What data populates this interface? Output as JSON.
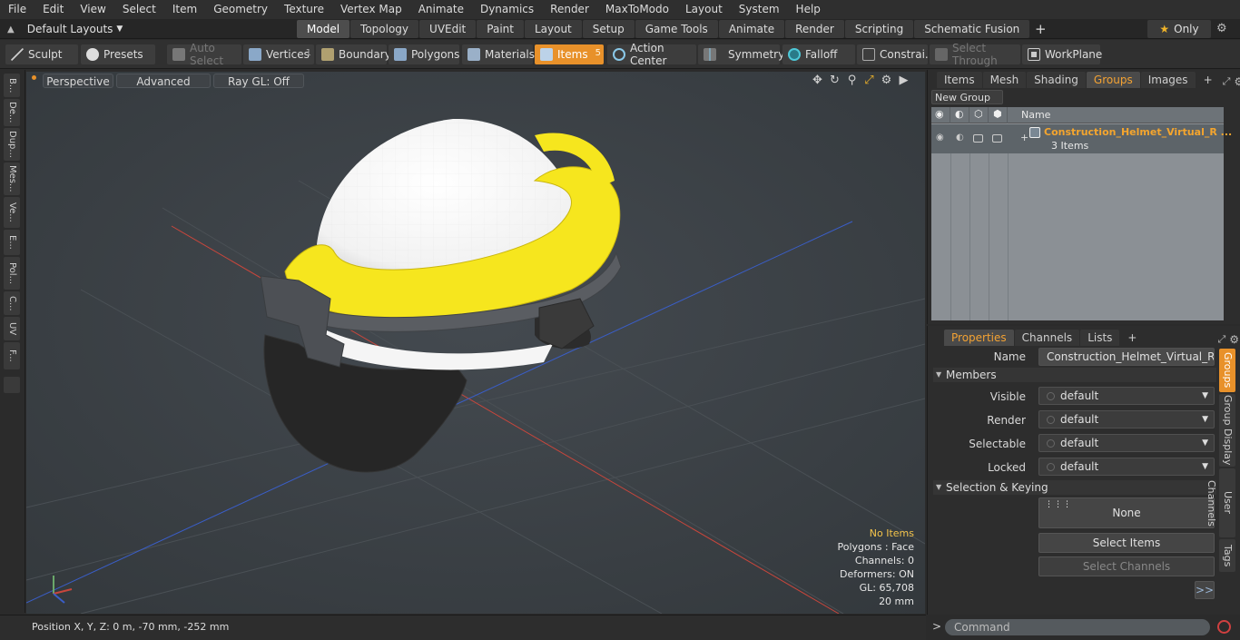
{
  "menu": [
    "File",
    "Edit",
    "View",
    "Select",
    "Item",
    "Geometry",
    "Texture",
    "Vertex Map",
    "Animate",
    "Dynamics",
    "Render",
    "MaxToModo",
    "Layout",
    "System",
    "Help"
  ],
  "layout": {
    "selector": "Default Layouts",
    "tabs": [
      "Model",
      "Topology",
      "UVEdit",
      "Paint",
      "Layout",
      "Setup",
      "Game Tools",
      "Animate",
      "Render",
      "Scripting",
      "Schematic Fusion"
    ],
    "active_tab": "Model",
    "only_label": "Only"
  },
  "toolbar": {
    "sculpt": "Sculpt",
    "presets": "Presets",
    "auto_select": "Auto Select",
    "vertices": "Vertices",
    "vertices_count": "1",
    "boundary": "Boundary",
    "polygons": "Polygons",
    "materials": "Materials",
    "items": "Items",
    "items_count": "5",
    "action_center": "Action Center",
    "symmetry": "Symmetry",
    "falloff": "Falloff",
    "constraints": "Constrai...",
    "select_through": "Select Through",
    "workplane": "WorkPlane"
  },
  "left_tabs": [
    "B...",
    "De...",
    "Dup...",
    "Mes...",
    "Ve...",
    "E...",
    "Pol...",
    "C...",
    "UV",
    "F..."
  ],
  "viewport": {
    "perspective": "Perspective",
    "advanced": "Advanced",
    "ray_gl": "Ray GL: Off",
    "stats": {
      "items": "No Items",
      "polygons": "Polygons : Face",
      "channels": "Channels: 0",
      "deformers": "Deformers: ON",
      "gl": "GL: 65,708",
      "scale": "20 mm"
    }
  },
  "status": {
    "position": "Position X, Y, Z:   0 m, -70 mm, -252 mm"
  },
  "groups_panel": {
    "tabs": [
      "Items",
      "Mesh ...",
      "Shading",
      "Groups",
      "Images"
    ],
    "active_tab": "Groups",
    "new_group": "New Group",
    "name_header": "Name",
    "group_name": "Construction_Helmet_Virtual_R ...",
    "group_count": "3 Items"
  },
  "properties_panel": {
    "tabs": [
      "Properties",
      "Channels",
      "Lists"
    ],
    "active_tab": "Properties",
    "name_label": "Name",
    "name_value": "Construction_Helmet_Virtual_Reality_",
    "members_section": "Members",
    "visible_label": "Visible",
    "visible_value": "default",
    "render_label": "Render",
    "render_value": "default",
    "selectable_label": "Selectable",
    "selectable_value": "default",
    "locked_label": "Locked",
    "locked_value": "default",
    "selection_section": "Selection & Keying",
    "none_button": "None",
    "select_items": "Select Items",
    "select_channels": "Select Channels",
    "expand": ">>",
    "side_tabs": [
      "Groups",
      "Group Display",
      "User Channels",
      "Tags"
    ]
  },
  "command": {
    "prompt": ">",
    "placeholder": "Command"
  },
  "colors": {
    "accent": "#e8912a",
    "highlight_text": "#f4a52e",
    "viewport_bg": "#3a3f44"
  }
}
